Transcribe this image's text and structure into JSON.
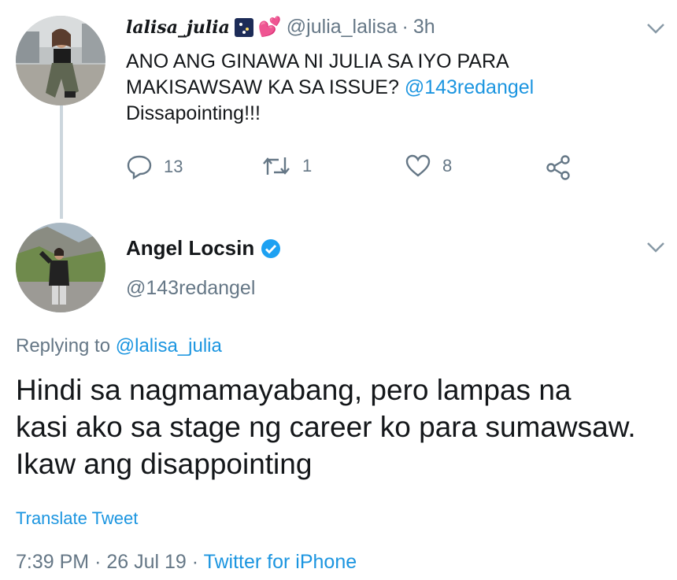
{
  "reply_tweet": {
    "display_name": "lalisa_julia",
    "handle": "@julia_lalisa",
    "separator": "·",
    "time": "3h",
    "body_lines": [
      "ANO ANG GINAWA NI JULIA SA IYO PARA",
      "MAKISAWSAW KA SA ISSUE?",
      "Dissapointing!!!"
    ],
    "body_mention": "@143redangel",
    "actions": {
      "reply_count": "13",
      "retweet_count": "1",
      "like_count": "8"
    }
  },
  "main_tweet": {
    "display_name": "Angel Locsin",
    "handle": "@143redangel",
    "replying_prefix": "Replying to",
    "replying_handle": "@lalisa_julia",
    "text_lines": [
      "Hindi sa nagmamayabang, pero  lampas na",
      "kasi ako sa stage ng career ko para sumawsaw.",
      "Ikaw ang disappointing"
    ],
    "translate_label": "Translate Tweet",
    "time": "7:39 PM",
    "sep1": "·",
    "date": "26 Jul 19",
    "sep2": "·",
    "source": "Twitter for iPhone"
  },
  "colors": {
    "link": "#1b95e0",
    "muted": "#657786",
    "text": "#14171a",
    "verified": "#1da1f2"
  },
  "icons": [
    "chevron-down-icon",
    "reply-icon",
    "retweet-icon",
    "like-icon",
    "share-icon",
    "verified-badge-icon"
  ]
}
